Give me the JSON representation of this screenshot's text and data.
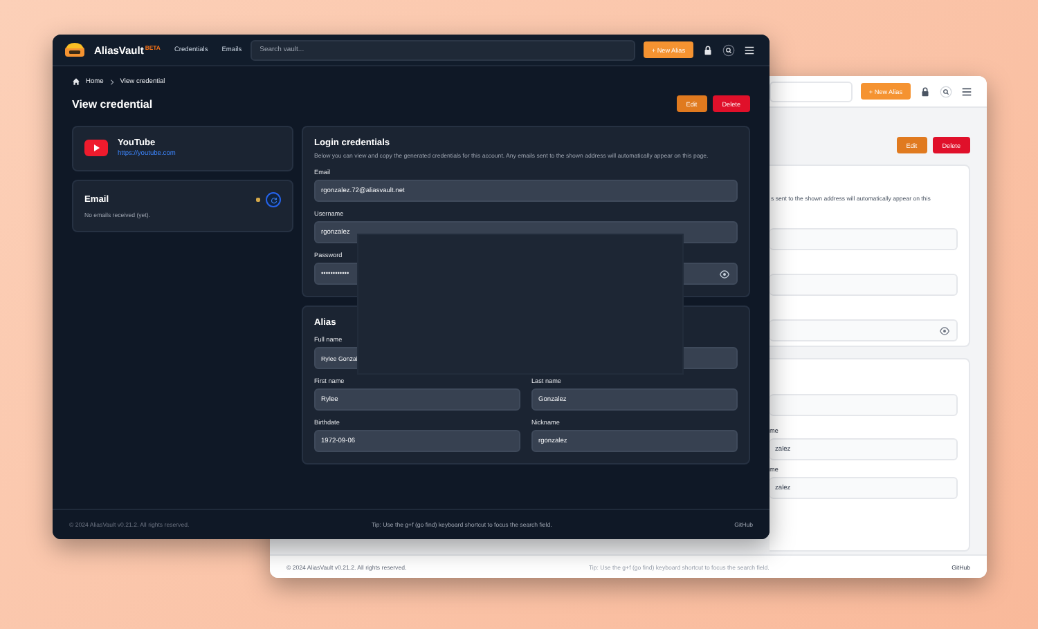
{
  "back_window": {
    "new_button": "+ New Alias",
    "actions": [
      "Edit",
      "Delete"
    ],
    "login_card": {
      "description": "s sent to the shown address will automatically appear on this"
    },
    "alias_card": {
      "fields": [
        {
          "label": "me",
          "value": "zalez"
        },
        {
          "label": "me",
          "value": "zalez"
        }
      ]
    },
    "footer": {
      "copyright": "© 2024 AliasVault v0.21.2. All rights reserved.",
      "tip": "Tip: Use the g+f (go find) keyboard shortcut to focus the search field.",
      "link": "GitHub"
    }
  },
  "main_window": {
    "brand": "AliasVault",
    "badge": "BETA",
    "nav": [
      "Credentials",
      "Emails"
    ],
    "search": {
      "placeholder": "Search vault..."
    },
    "new_button": "+ New Alias",
    "breadcrumb": [
      "Home",
      "View credential"
    ],
    "title": "View credential",
    "actions": [
      "Edit",
      "Delete"
    ],
    "service": {
      "name": "YouTube",
      "url": "https://youtube.com"
    },
    "email_card": {
      "title": "Email",
      "message": "No emails received (yet)."
    },
    "login_card": {
      "title": "Login credentials",
      "description": "Below you can view and copy the generated credentials for this account. Any emails sent to the shown address will automatically appear on this page.",
      "fields": [
        {
          "label": "Email",
          "value": "rgonzalez.72@aliasvault.net",
          "kind": "text"
        },
        {
          "label": "Username",
          "value": "rgonzalez",
          "kind": "text"
        },
        {
          "label": "Password",
          "value": "••••••••••••",
          "kind": "password"
        }
      ]
    },
    "alias_card": {
      "title": "Alias",
      "full_name": {
        "label": "Full name",
        "value": "Rylee Gonzal"
      },
      "fields": [
        {
          "label": "First name",
          "value": "Rylee"
        },
        {
          "label": "Last name",
          "value": "Gonzalez"
        },
        {
          "label": "Birthdate",
          "value": "1972-09-06"
        },
        {
          "label": "Nickname",
          "value": "rgonzalez"
        }
      ]
    },
    "footer": {
      "copyright": "© 2024 AliasVault v0.21.2. All rights reserved.",
      "tip": "Tip: Use the g+f (go find) keyboard shortcut to focus the search field.",
      "link": "GitHub"
    }
  }
}
